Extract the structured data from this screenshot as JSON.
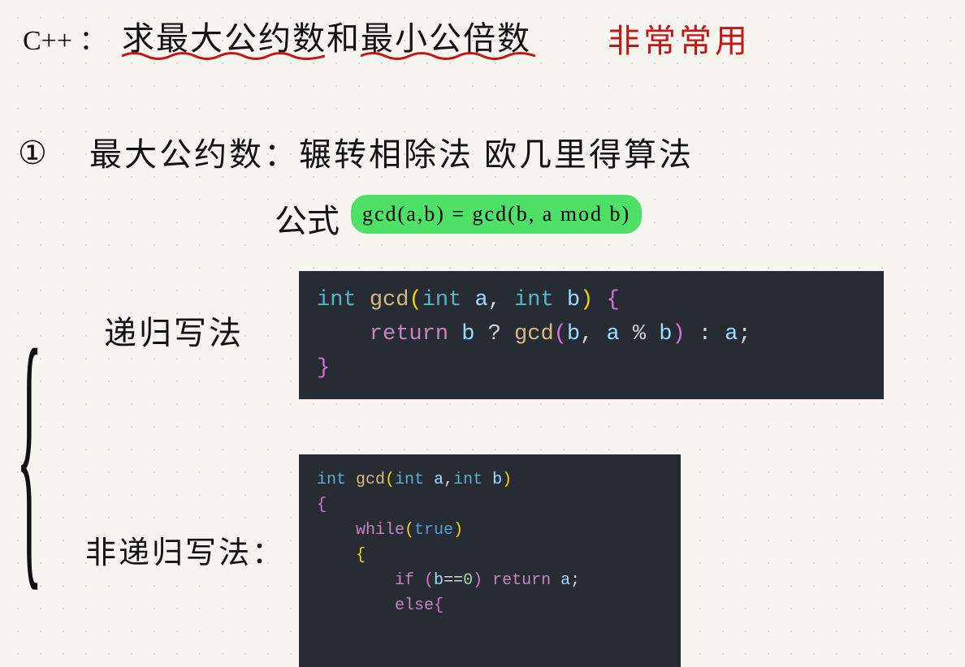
{
  "title": {
    "prefix": "C++ ：",
    "main1": "求最大公约数",
    "connector": "和",
    "main2": "最小公倍数",
    "aside": "非常常用"
  },
  "section1": {
    "marker": "①",
    "heading": "最大公约数：辗转相除法  欧几里得算法",
    "formula_label": "公式",
    "formula": "gcd(a,b) = gcd(b, a mod b)"
  },
  "labels": {
    "recursive": "递归写法",
    "nonrecursive": "非递归写法："
  },
  "code1": {
    "lines": [
      {
        "tokens": [
          [
            "type",
            "int "
          ],
          [
            "func",
            "gcd"
          ],
          [
            "p",
            "("
          ],
          [
            "type",
            "int "
          ],
          [
            "var",
            "a"
          ],
          [
            "op",
            ", "
          ],
          [
            "type",
            "int "
          ],
          [
            "var",
            "b"
          ],
          [
            "p",
            ") "
          ],
          [
            "pm",
            "{"
          ]
        ]
      },
      {
        "tokens": [
          [
            "op",
            "    "
          ],
          [
            "key",
            "return "
          ],
          [
            "var",
            "b"
          ],
          [
            "op",
            " ? "
          ],
          [
            "func",
            "gcd"
          ],
          [
            "pm",
            "("
          ],
          [
            "var",
            "b"
          ],
          [
            "op",
            ", "
          ],
          [
            "var",
            "a"
          ],
          [
            "op",
            " % "
          ],
          [
            "var",
            "b"
          ],
          [
            "pm",
            ")"
          ],
          [
            "op",
            " : "
          ],
          [
            "var",
            "a"
          ],
          [
            "op",
            ";"
          ]
        ]
      },
      {
        "tokens": [
          [
            "pm",
            "}"
          ]
        ]
      }
    ]
  },
  "code2": {
    "lines": [
      {
        "tokens": [
          [
            "type",
            "int "
          ],
          [
            "func",
            "gcd"
          ],
          [
            "p",
            "("
          ],
          [
            "type",
            "int "
          ],
          [
            "var",
            "a"
          ],
          [
            "op",
            ","
          ],
          [
            "type",
            "int "
          ],
          [
            "var",
            "b"
          ],
          [
            "p",
            ")"
          ]
        ]
      },
      {
        "tokens": [
          [
            "pm",
            "{"
          ]
        ]
      },
      {
        "tokens": [
          [
            "op",
            "    "
          ],
          [
            "key",
            "while"
          ],
          [
            "p",
            "("
          ],
          [
            "bool",
            "true"
          ],
          [
            "p",
            ")"
          ]
        ]
      },
      {
        "tokens": [
          [
            "op",
            "    "
          ],
          [
            "p",
            "{"
          ]
        ]
      },
      {
        "tokens": [
          [
            "op",
            "        "
          ],
          [
            "key",
            "if "
          ],
          [
            "pm",
            "("
          ],
          [
            "var",
            "b"
          ],
          [
            "op",
            "=="
          ],
          [
            "num",
            "0"
          ],
          [
            "pm",
            ")"
          ],
          [
            "key",
            " return "
          ],
          [
            "var",
            "a"
          ],
          [
            "op",
            ";"
          ]
        ]
      },
      {
        "tokens": [
          [
            "op",
            "        "
          ],
          [
            "key",
            "else"
          ],
          [
            "pm",
            "{"
          ]
        ]
      }
    ]
  }
}
